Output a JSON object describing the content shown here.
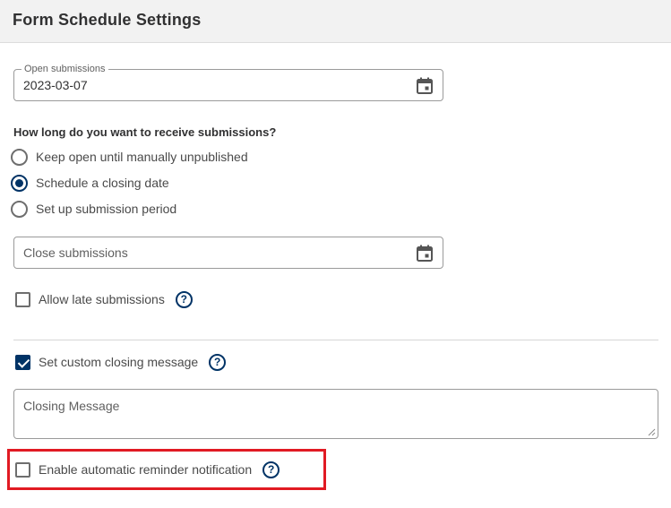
{
  "header": {
    "title": "Form Schedule Settings"
  },
  "open_submissions": {
    "legend": "Open submissions",
    "value": "2023-03-07",
    "icon": "calendar-icon"
  },
  "question": "How long do you want to receive submissions?",
  "radio_options": [
    {
      "label": "Keep open until manually unpublished",
      "selected": false
    },
    {
      "label": "Schedule a closing date",
      "selected": true
    },
    {
      "label": "Set up submission period",
      "selected": false
    }
  ],
  "close_submissions": {
    "placeholder": "Close submissions",
    "icon": "calendar-icon"
  },
  "allow_late": {
    "label": "Allow late submissions",
    "checked": false
  },
  "custom_message": {
    "label": "Set custom closing message",
    "checked": true
  },
  "closing_message": {
    "placeholder": "Closing Message"
  },
  "reminder": {
    "label": "Enable automatic reminder notification",
    "checked": false
  },
  "help_glyph": "?",
  "colors": {
    "accent": "#003366",
    "highlight": "#e11a23",
    "header_bg": "#f2f2f2"
  }
}
